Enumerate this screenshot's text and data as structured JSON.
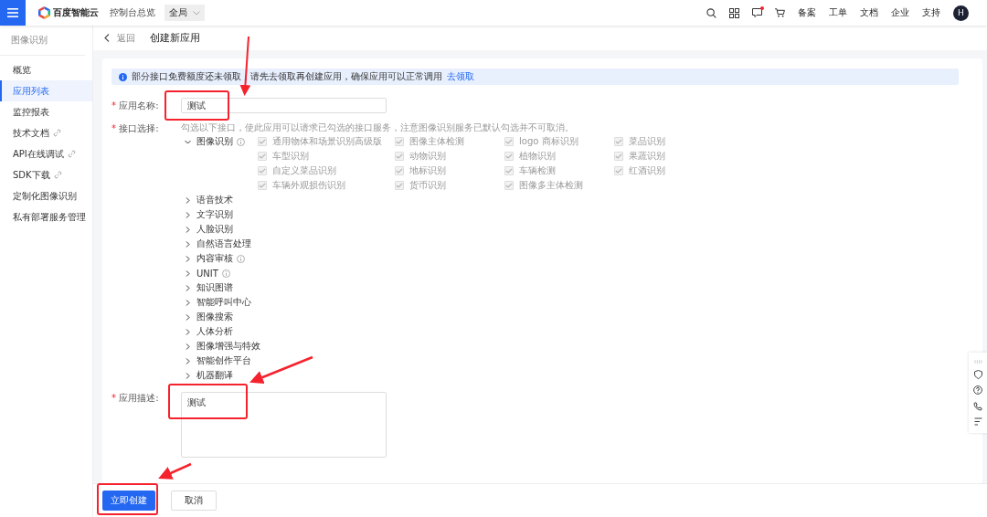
{
  "header": {
    "logo_text": "百度智能云",
    "console_link": "控制台总览",
    "region_select": "全局",
    "notification_dot": true,
    "nav_links": [
      "备案",
      "工单",
      "文档",
      "企业",
      "支持"
    ],
    "avatar": "H"
  },
  "sidebar": {
    "title": "图像识别",
    "items": [
      {
        "label": "概览",
        "selected": false,
        "external": false
      },
      {
        "label": "应用列表",
        "selected": true,
        "external": false
      },
      {
        "label": "监控报表",
        "selected": false,
        "external": false
      },
      {
        "label": "技术文档",
        "selected": false,
        "external": true
      },
      {
        "label": "API在线调试",
        "selected": false,
        "external": true
      },
      {
        "label": "SDK下载",
        "selected": false,
        "external": true
      },
      {
        "label": "定制化图像识别",
        "selected": false,
        "external": false
      },
      {
        "label": "私有部署服务管理",
        "selected": false,
        "external": false
      }
    ]
  },
  "breadcrumb": {
    "back": "返回",
    "title": "创建新应用"
  },
  "notice": {
    "text": "部分接口免费额度还未领取，请先去领取再创建应用，确保应用可以正常调用",
    "link": "去领取"
  },
  "form": {
    "name": {
      "mark": "*",
      "label": "应用名称:",
      "value": "测试"
    },
    "api": {
      "mark": "*",
      "label": "接口选择:",
      "hint": "勾选以下接口，使此应用可以请求已勾选的接口服务，注意图像识别服务已默认勾选并不可取消。",
      "groups": [
        {
          "label": "图像识别",
          "expanded": true,
          "info": true,
          "options": [
            {
              "label": "通用物体和场景识别高级版",
              "checked": true,
              "disabled": true
            },
            {
              "label": "图像主体检测",
              "checked": true,
              "disabled": true
            },
            {
              "label": "logo 商标识别",
              "checked": true,
              "disabled": true
            },
            {
              "label": "菜品识别",
              "checked": true,
              "disabled": true
            },
            {
              "label": "车型识别",
              "checked": true,
              "disabled": true
            },
            {
              "label": "动物识别",
              "checked": true,
              "disabled": true
            },
            {
              "label": "植物识别",
              "checked": true,
              "disabled": true
            },
            {
              "label": "果蔬识别",
              "checked": true,
              "disabled": true
            },
            {
              "label": "自定义菜品识别",
              "checked": true,
              "disabled": true
            },
            {
              "label": "地标识别",
              "checked": true,
              "disabled": true
            },
            {
              "label": "车辆检测",
              "checked": true,
              "disabled": true
            },
            {
              "label": "红酒识别",
              "checked": true,
              "disabled": true
            },
            {
              "label": "车辆外观损伤识别",
              "checked": true,
              "disabled": true
            },
            {
              "label": "货币识别",
              "checked": true,
              "disabled": true
            },
            {
              "label": "图像多主体检测",
              "checked": true,
              "disabled": true
            }
          ]
        },
        {
          "label": "语音技术",
          "expanded": false,
          "info": false
        },
        {
          "label": "文字识别",
          "expanded": false,
          "info": false
        },
        {
          "label": "人脸识别",
          "expanded": false,
          "info": false
        },
        {
          "label": "自然语言处理",
          "expanded": false,
          "info": false
        },
        {
          "label": "内容审核",
          "expanded": false,
          "info": true
        },
        {
          "label": "UNIT",
          "expanded": false,
          "info": true
        },
        {
          "label": "知识图谱",
          "expanded": false,
          "info": false
        },
        {
          "label": "智能呼叫中心",
          "expanded": false,
          "info": false
        },
        {
          "label": "图像搜索",
          "expanded": false,
          "info": false
        },
        {
          "label": "人体分析",
          "expanded": false,
          "info": false
        },
        {
          "label": "图像增强与特效",
          "expanded": false,
          "info": false
        },
        {
          "label": "智能创作平台",
          "expanded": false,
          "info": false
        },
        {
          "label": "机器翻译",
          "expanded": false,
          "info": false
        }
      ]
    },
    "description": {
      "mark": "*",
      "label": "应用描述:",
      "value": "测试"
    }
  },
  "buttons": [
    {
      "label": "立即创建",
      "kind": "primary"
    },
    {
      "label": "取消",
      "kind": "default"
    }
  ]
}
